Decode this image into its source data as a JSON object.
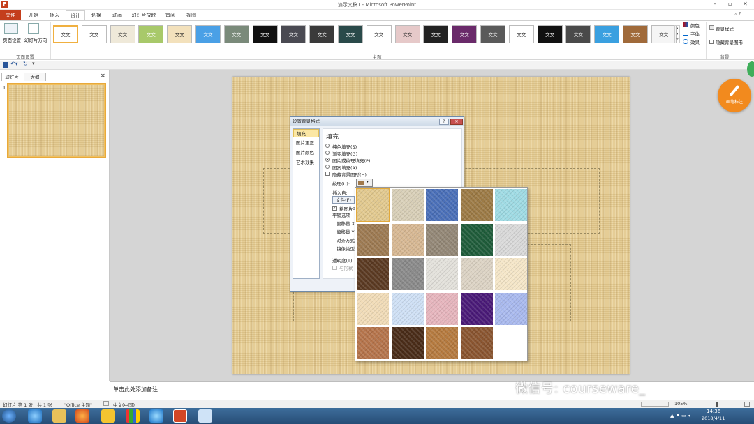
{
  "app": {
    "title": "演示文稿1 - Microsoft PowerPoint",
    "icon": "powerpoint-icon"
  },
  "tabs": [
    {
      "label": "文件"
    },
    {
      "label": "开始"
    },
    {
      "label": "插入"
    },
    {
      "label": "设计"
    },
    {
      "label": "切换"
    },
    {
      "label": "动画"
    },
    {
      "label": "幻灯片放映"
    },
    {
      "label": "审阅"
    },
    {
      "label": "视图"
    }
  ],
  "ribbon": {
    "page_setup": {
      "btn1": "页面设置",
      "btn2": "幻灯片方向",
      "group": "页面设置"
    },
    "themes": {
      "sample": "文文",
      "group": "主题"
    },
    "theme_options": {
      "colors": "颜色",
      "fonts": "字体",
      "effects": "效果"
    },
    "background": {
      "styles": "背景样式",
      "hide": "隐藏背景图形",
      "group": "背景"
    }
  },
  "panes": {
    "slides_tab": "幻灯片",
    "outline_tab": "大纲",
    "slide_number": "1"
  },
  "notes": {
    "placeholder": "单击此处添加备注"
  },
  "status": {
    "slide_info": "幻灯片 第 1 张，共 1 张",
    "theme": "\"Office 主题\"",
    "language": "中文(中国)",
    "zoom": "105%"
  },
  "taskbar": {
    "time": "14:36",
    "date": "2018/4/11"
  },
  "dialog": {
    "title": "设置背景格式",
    "categories": [
      "填充",
      "图片更正",
      "图片颜色",
      "艺术效果"
    ],
    "heading": "填充",
    "fill_options": [
      "纯色填充(S)",
      "渐变填充(G)",
      "图片或纹理填充(P)",
      "图案填充(A)"
    ],
    "hide_bg": "隐藏背景图形(H)",
    "texture_label": "纹理(U):",
    "insert_from": "插入自:",
    "file_btn": "文件(F)",
    "tile_option": "将图片平",
    "tile_options_label": "平铺选项",
    "offset_x": "偏移量 X",
    "offset_y": "偏移量 Y",
    "alignment": "对齐方式",
    "mirror": "镜像类型",
    "transparency": "透明度(T)",
    "rotate_with_shape": "与形状一"
  },
  "textures": [
    {
      "name": "纸莎草纸",
      "color": "#e2c98f"
    },
    {
      "name": "画布",
      "color": "#d8cfb7"
    },
    {
      "name": "斜纹布",
      "color": "#4a6fb8"
    },
    {
      "name": "编织物",
      "color": "#9c7a45"
    },
    {
      "name": "水滴",
      "color": "#9fdbe4"
    },
    {
      "name": "纸袋",
      "color": "#9d7a52"
    },
    {
      "name": "鱼类化石",
      "color": "#d7b893"
    },
    {
      "name": "沙滩",
      "color": "#938776"
    },
    {
      "name": "绿色大理石",
      "color": "#1f5c3a"
    },
    {
      "name": "白色大理石",
      "color": "#d9d9d9"
    },
    {
      "name": "褐色大理石",
      "color": "#5b3a22"
    },
    {
      "name": "花岗岩",
      "color": "#8a8a8a"
    },
    {
      "name": "新闻纸",
      "color": "#e3e1db"
    },
    {
      "name": "再生纸",
      "color": "#dcd3c4"
    },
    {
      "name": "羊皮纸",
      "color": "#f5e6c8"
    },
    {
      "name": "信纸",
      "color": "#f1dcb8"
    },
    {
      "name": "蓝色面巾纸",
      "color": "#cfe0f5"
    },
    {
      "name": "粉色面巾纸",
      "color": "#e6b5bd"
    },
    {
      "name": "紫色网格",
      "color": "#4a1a78"
    },
    {
      "name": "花束",
      "color": "#a9b9ee"
    },
    {
      "name": "软木塞",
      "color": "#b5744b"
    },
    {
      "name": "胡桃",
      "color": "#4a2c18"
    },
    {
      "name": "栎木",
      "color": "#b57a3f"
    },
    {
      "name": "中等木材",
      "color": "#8a5530"
    }
  ],
  "watermark": {
    "text": "微信号: courseware_"
  },
  "pen_badge": {
    "label": "画笔标注"
  }
}
